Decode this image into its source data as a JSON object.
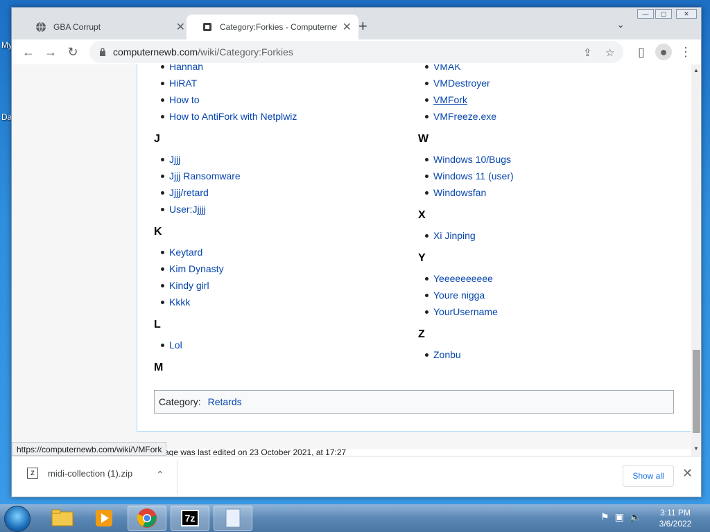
{
  "desktop": {
    "labels": [
      "My",
      "Da"
    ]
  },
  "browser": {
    "tabs": [
      {
        "title": "GBA Corrupt",
        "icon": "globe-icon"
      },
      {
        "title": "Category:Forkies - Computernewb",
        "icon": "wiki-icon"
      }
    ],
    "url_domain": "computernewb.com",
    "url_path": "/wiki/Category:Forkies"
  },
  "page": {
    "left_column": {
      "top_items": [
        "Hannah",
        "HiRAT",
        "How to",
        "How to AntiFork with Netplwiz"
      ],
      "groups": [
        {
          "letter": "J",
          "items": [
            "Jjjj",
            "Jjjj Ransomware",
            "Jjjj/retard",
            "User:Jjjjj"
          ]
        },
        {
          "letter": "K",
          "items": [
            "Keytard",
            "Kim Dynasty",
            "Kindy girl",
            "Kkkk"
          ]
        },
        {
          "letter": "L",
          "items": [
            "Lol"
          ]
        },
        {
          "letter": "M",
          "items": []
        }
      ]
    },
    "right_column": {
      "top_items": [
        "VMAK",
        "VMDestroyer",
        "VMFork",
        "VMFreeze.exe"
      ],
      "groups": [
        {
          "letter": "W",
          "items": [
            "Windows 10/Bugs",
            "Windows 11 (user)",
            "Windowsfan"
          ]
        },
        {
          "letter": "X",
          "items": [
            "Xi Jinping"
          ]
        },
        {
          "letter": "Y",
          "items": [
            "Yeeeeeeeeee",
            "Youre nigga",
            "YourUsername"
          ]
        },
        {
          "letter": "Z",
          "items": [
            "Zonbu"
          ]
        }
      ]
    },
    "category_label": "Category:",
    "category_link": "Retards",
    "footer_text": "age was last edited on 23 October 2021, at 17:27",
    "status_url": "https://computernewb.com/wiki/VMFork"
  },
  "downloads": {
    "file_name": "midi-collection (1).zip",
    "file_icon_label": "Z",
    "show_all_label": "Show all"
  },
  "taskbar": {
    "time": "3:11 PM",
    "date": "3/6/2022",
    "apps": [
      "explorer-icon",
      "media-player-icon",
      "chrome-icon",
      "7zip-icon",
      "notepad-icon"
    ],
    "seven_zip_label": "7z"
  }
}
